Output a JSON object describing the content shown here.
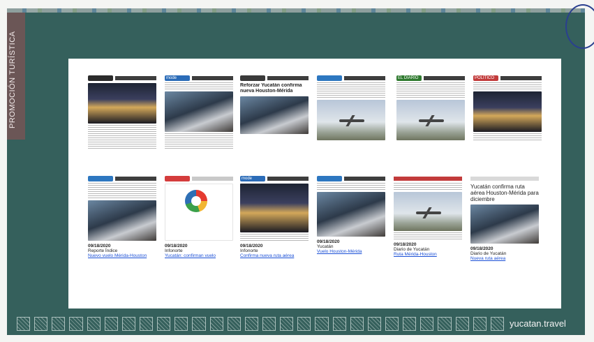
{
  "sidebar_label": "PROMOCIÓN TURÍSTICA",
  "brand": "yucatan.travel",
  "row1": [
    {
      "logo": "",
      "logo_color": "#2b2b2b",
      "headline": "",
      "image": "city",
      "date": "",
      "source": "",
      "link": ""
    },
    {
      "logo": "mode",
      "logo_color": "#2b6cb8",
      "headline": "",
      "image": "people",
      "date": "",
      "source": "",
      "link": ""
    },
    {
      "logo": "",
      "logo_color": "#3a3a3a",
      "headline": "Reforzar Yucatán confirma nueva Houston-Mérida",
      "image": "people",
      "date": "",
      "source": "",
      "link": ""
    },
    {
      "logo": "",
      "logo_color": "#2d77c0",
      "headline": "",
      "image": "sky",
      "date": "",
      "source": "",
      "link": ""
    },
    {
      "logo": "EL DIARIO",
      "logo_color": "#2f7a2f",
      "headline": "",
      "image": "sky",
      "date": "",
      "source": "",
      "link": ""
    },
    {
      "logo": "POLÍTICO",
      "logo_color": "#c23b3b",
      "headline": "",
      "image": "city",
      "date": "",
      "source": "",
      "link": ""
    }
  ],
  "row2": [
    {
      "logo": "",
      "logo_color": "#2d77c0",
      "headline": "",
      "image": "people",
      "date": "09/18/2020",
      "source": "Reporte Índice",
      "link": "Nuevo vuelo Mérida-Houston"
    },
    {
      "logo": "",
      "logo_color": "#d43c3c",
      "headline": "",
      "image": "white",
      "date": "09/18/2020",
      "source": "Infonorte",
      "link": "Yucatán: confirman vuelo"
    },
    {
      "logo": "mode",
      "logo_color": "#2b6cb8",
      "headline": "",
      "image": "city",
      "date": "09/18/2020",
      "source": "Infonorte",
      "link": "Confirma nueva ruta aérea"
    },
    {
      "logo": "",
      "logo_color": "#2d77c0",
      "headline": "",
      "image": "people",
      "date": "09/18/2020",
      "source": "Yucatán",
      "link": "Vuelo Houston-Mérida"
    },
    {
      "logo": "",
      "logo_color": "#c23b3b",
      "headline": "",
      "image": "sky",
      "date": "09/18/2020",
      "source": "Diario de Yucatán",
      "link": "Ruta Mérida-Houston"
    },
    {
      "logo": "",
      "logo_color": "#cfcfcf",
      "headline": "Yucatán confirma ruta aérea Houston-Mérida para diciembre",
      "image": "people",
      "date": "09/18/2020",
      "source": "Diario de Yucatán",
      "link": "Nueva ruta aérea"
    }
  ]
}
